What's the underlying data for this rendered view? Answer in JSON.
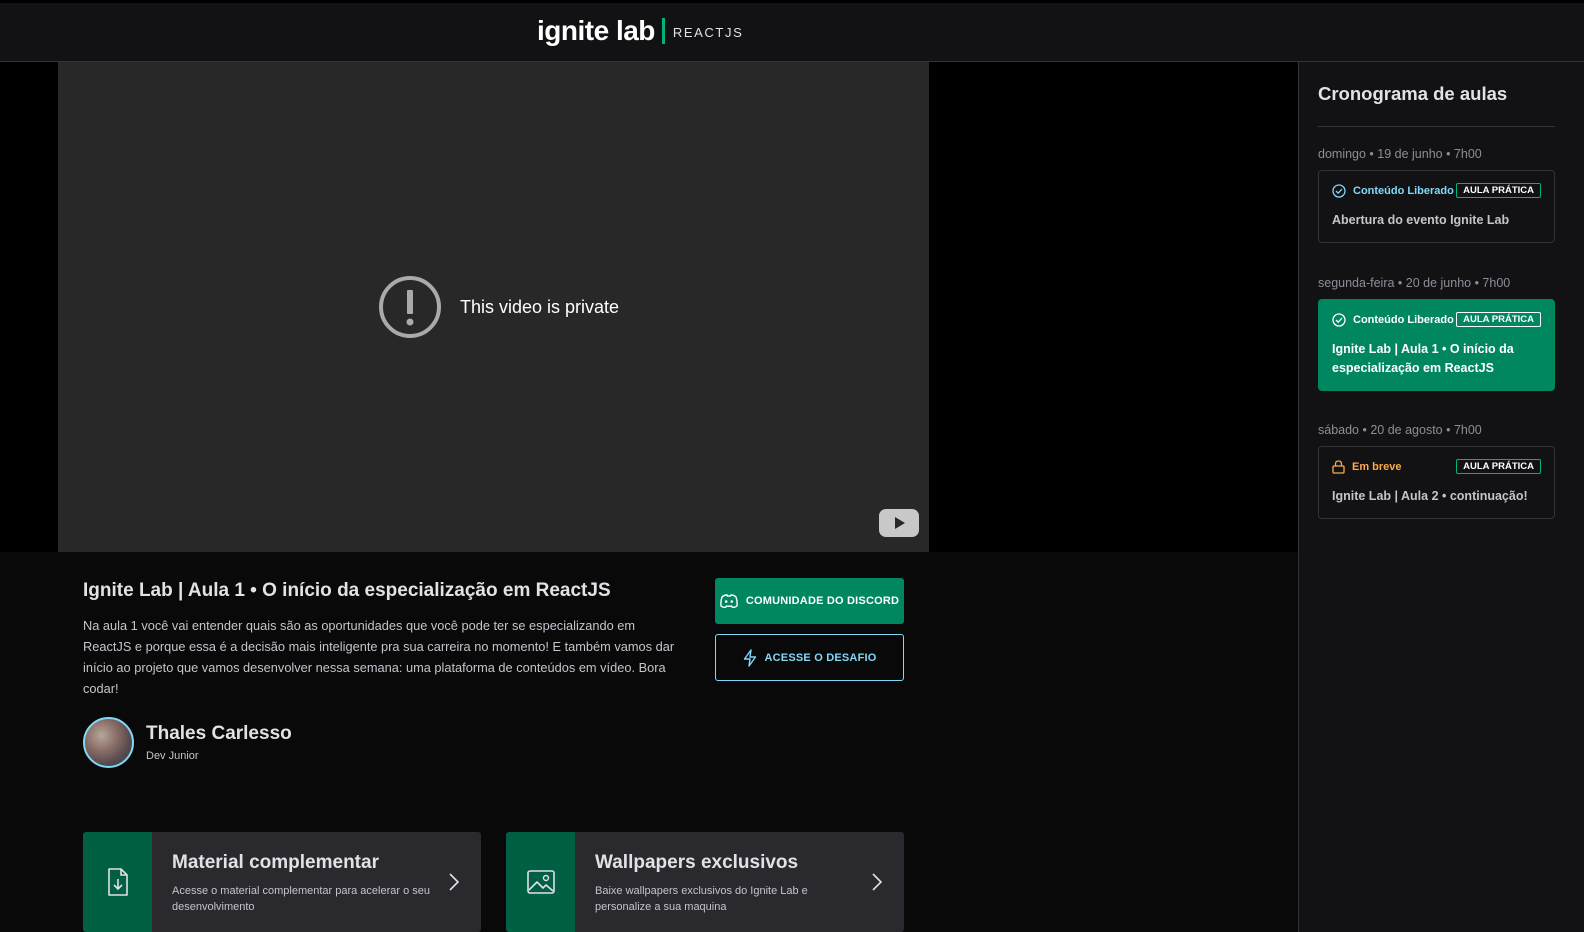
{
  "header": {
    "logo_main": "ignite lab",
    "logo_sub": "REACTJS"
  },
  "video": {
    "message": "This video is private",
    "platform_icon": "youtube-icon"
  },
  "lesson": {
    "title": "Ignite Lab | Aula 1 • O início da especialização em ReactJS",
    "description": "Na aula 1 você vai entender quais são as oportunidades que você pode ter se especializando em ReactJS e porque essa é a decisão mais inteligente pra sua carreira no momento! E também vamos dar início ao projeto que vamos desenvolver nessa semana: uma plataforma de conteúdos em vídeo. Bora codar!",
    "teacher": {
      "name": "Thales Carlesso",
      "role": "Dev Junior"
    },
    "buttons": {
      "discord": "COMUNIDADE DO DISCORD",
      "challenge": "ACESSE O DESAFIO"
    }
  },
  "cards": [
    {
      "title": "Material complementar",
      "text": "Acesse o material complementar para acelerar o seu desenvolvimento",
      "icon": "file-download-icon"
    },
    {
      "title": "Wallpapers exclusivos",
      "text": "Baixe wallpapers exclusivos do Ignite Lab e personalize a sua maquina",
      "icon": "image-icon"
    }
  ],
  "sidebar": {
    "title": "Cronograma de aulas",
    "lessons": [
      {
        "date": "domingo • 19 de junho • 7h00",
        "status": "Conteúdo Liberado",
        "tag": "AULA PRÁTICA",
        "name": "Abertura do evento Ignite Lab",
        "active": false
      },
      {
        "date": "segunda-feira • 20 de junho • 7h00",
        "status": "Conteúdo Liberado",
        "tag": "AULA PRÁTICA",
        "name": "Ignite Lab | Aula 1 • O início da especialização em ReactJS",
        "active": true
      },
      {
        "date": "sábado • 20 de agosto • 7h00",
        "status": "Em breve",
        "tag": "AULA PRÁTICA",
        "name": "Ignite Lab | Aula 2 • continuação!",
        "active": false
      }
    ]
  },
  "colors": {
    "brand_green": "#00875f",
    "accent_blue": "#81d8f7",
    "warning_orange": "#fba94c"
  }
}
